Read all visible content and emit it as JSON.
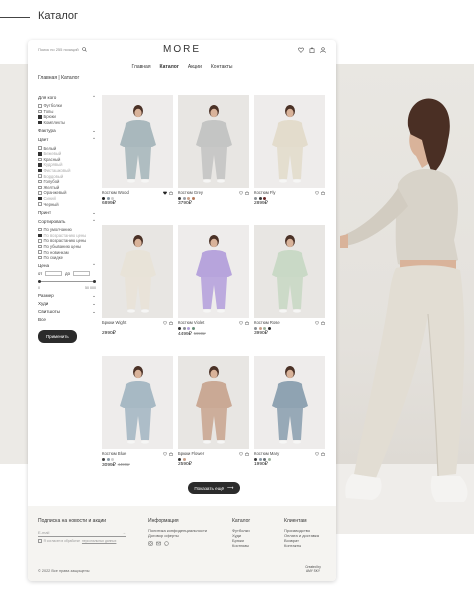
{
  "page_heading": "Каталог",
  "header": {
    "search_placeholder": "Поиск по 255 позиций",
    "logo": "MORE",
    "nav": [
      "Главная",
      "Каталог",
      "Акции",
      "Контакты"
    ],
    "nav_active": 1,
    "icons": [
      "heart-icon",
      "bag-icon",
      "user-icon"
    ]
  },
  "breadcrumb": "Главная | Каталог",
  "filters": {
    "for_whom": {
      "title": "Для кого",
      "options": [
        {
          "label": "Футболки",
          "checked": false
        },
        {
          "label": "Топы",
          "checked": false
        },
        {
          "label": "Брюки",
          "checked": true
        },
        {
          "label": "Комплекты",
          "checked": true
        }
      ]
    },
    "texture": {
      "title": "Фактура"
    },
    "color": {
      "title": "Цвет",
      "options": [
        {
          "label": "Белый",
          "checked": false,
          "faded": false
        },
        {
          "label": "Бежевый",
          "checked": true,
          "faded": true
        },
        {
          "label": "Красный",
          "checked": false,
          "faded": false
        },
        {
          "label": "Кудрявый",
          "checked": true,
          "faded": true
        },
        {
          "label": "Фисташковый",
          "checked": true,
          "faded": true
        },
        {
          "label": "Бордовый",
          "checked": false,
          "faded": true
        },
        {
          "label": "Голубой",
          "checked": false,
          "faded": false
        },
        {
          "label": "Желтый",
          "checked": false,
          "faded": false
        },
        {
          "label": "Оранжевый",
          "checked": false,
          "faded": false
        },
        {
          "label": "Синий",
          "checked": true,
          "faded": true
        },
        {
          "label": "Черный",
          "checked": false,
          "faded": false
        }
      ]
    },
    "print": {
      "title": "Принт"
    },
    "sort": {
      "title": "Сортировать",
      "options": [
        {
          "label": "По умолчанию",
          "checked": false,
          "faded": false
        },
        {
          "label": "По возрастанию цены",
          "checked": true,
          "faded": true
        },
        {
          "label": "По возрастанию цены",
          "checked": false,
          "faded": false
        },
        {
          "label": "По убыванию цены",
          "checked": false,
          "faded": false
        },
        {
          "label": "По новинкам",
          "checked": false,
          "faded": false
        },
        {
          "label": "По скидке",
          "checked": false,
          "faded": false
        }
      ]
    },
    "price": {
      "title": "Цена",
      "from_label": "от",
      "to_label": "до",
      "min": "0",
      "max": "50 000",
      "range_fraction": [
        0.0,
        1.0
      ]
    },
    "size": {
      "title": "Размер"
    },
    "extra": [
      "Худи",
      "Свитшоты",
      "Все"
    ],
    "apply_label": "Применить"
  },
  "products": [
    {
      "name": "Костюм Wood",
      "price": "6899₽",
      "old_price": "",
      "swatches": [
        "#222222",
        "#8a9aa5",
        "#cfcfcf"
      ],
      "cloth": "#a9b8bd",
      "liked": true
    },
    {
      "name": "Костюм Grey",
      "price": "3790₽",
      "old_price": "",
      "swatches": [
        "#444444",
        "#9aa0a6",
        "#c9a08a",
        "#b57a5c"
      ],
      "cloth": "#c4c5c4",
      "liked": false
    },
    {
      "name": "Костюм Fly",
      "price": "2899₽",
      "old_price": "",
      "swatches": [
        "#8a8f94",
        "#3b3b3b",
        "#6b2a2a"
      ],
      "cloth": "#e3dccc",
      "liked": false
    },
    {
      "name": "Брюки Wight",
      "price": "2990₽",
      "old_price": "",
      "swatches": [],
      "cloth": "#e8e3d8",
      "liked": false
    },
    {
      "name": "Костюм Violet",
      "price": "4499₽",
      "old_price": "5990₽",
      "swatches": [
        "#333333",
        "#8a8f94",
        "#b0a0d8",
        "#6a8f7a"
      ],
      "cloth": "#b7a4dc",
      "liked": false
    },
    {
      "name": "Костюм Rose",
      "price": "3990₽",
      "old_price": "",
      "swatches": [
        "#8a8f94",
        "#c9a08a",
        "#a0b5a0",
        "#333333"
      ],
      "cloth": "#c9d9c6",
      "liked": false
    },
    {
      "name": "Костюм Blue",
      "price": "3099₽",
      "old_price": "4499₽",
      "swatches": [
        "#444444",
        "#8a9aa5",
        "#cfcfcf"
      ],
      "cloth": "#a7b9c4",
      "liked": false
    },
    {
      "name": "Брюки Flower",
      "price": "2590₽",
      "old_price": "",
      "swatches": [
        "#333333",
        "#c9a08a"
      ],
      "cloth": "#caa995",
      "liked": false
    },
    {
      "name": "Костюм Mary",
      "price": "1990₽",
      "old_price": "",
      "swatches": [
        "#3b3b3b",
        "#8a9aa5",
        "#6a6f74",
        "#a0b5a0"
      ],
      "cloth": "#8fa3b2",
      "liked": false
    }
  ],
  "show_more_label": "Показать ещё",
  "footer": {
    "newsletter": {
      "title": "Подписка на новости и акции",
      "email_placeholder": "E-mail",
      "agree_text": "Я согласен в обработке",
      "agree_link": "персональных данных"
    },
    "info": {
      "title": "Информация",
      "links": [
        "Политика конфиденциальности",
        "Договор оферты"
      ]
    },
    "catalog": {
      "title": "Каталог",
      "links": [
        "Футболки",
        "Худи",
        "Брюки",
        "Костюмы"
      ]
    },
    "clients": {
      "title": "Клиентам",
      "links": [
        "Производство",
        "Оплата и доставка",
        "Возврат",
        "Контакты"
      ]
    },
    "copyright": "© 2022 Все права защищены",
    "studio": "Created by AMY SKY"
  },
  "colors": {
    "accent_dark": "#2b2b2b",
    "background_band": "#eceae6",
    "footer_bg": "#f5f4f1"
  }
}
